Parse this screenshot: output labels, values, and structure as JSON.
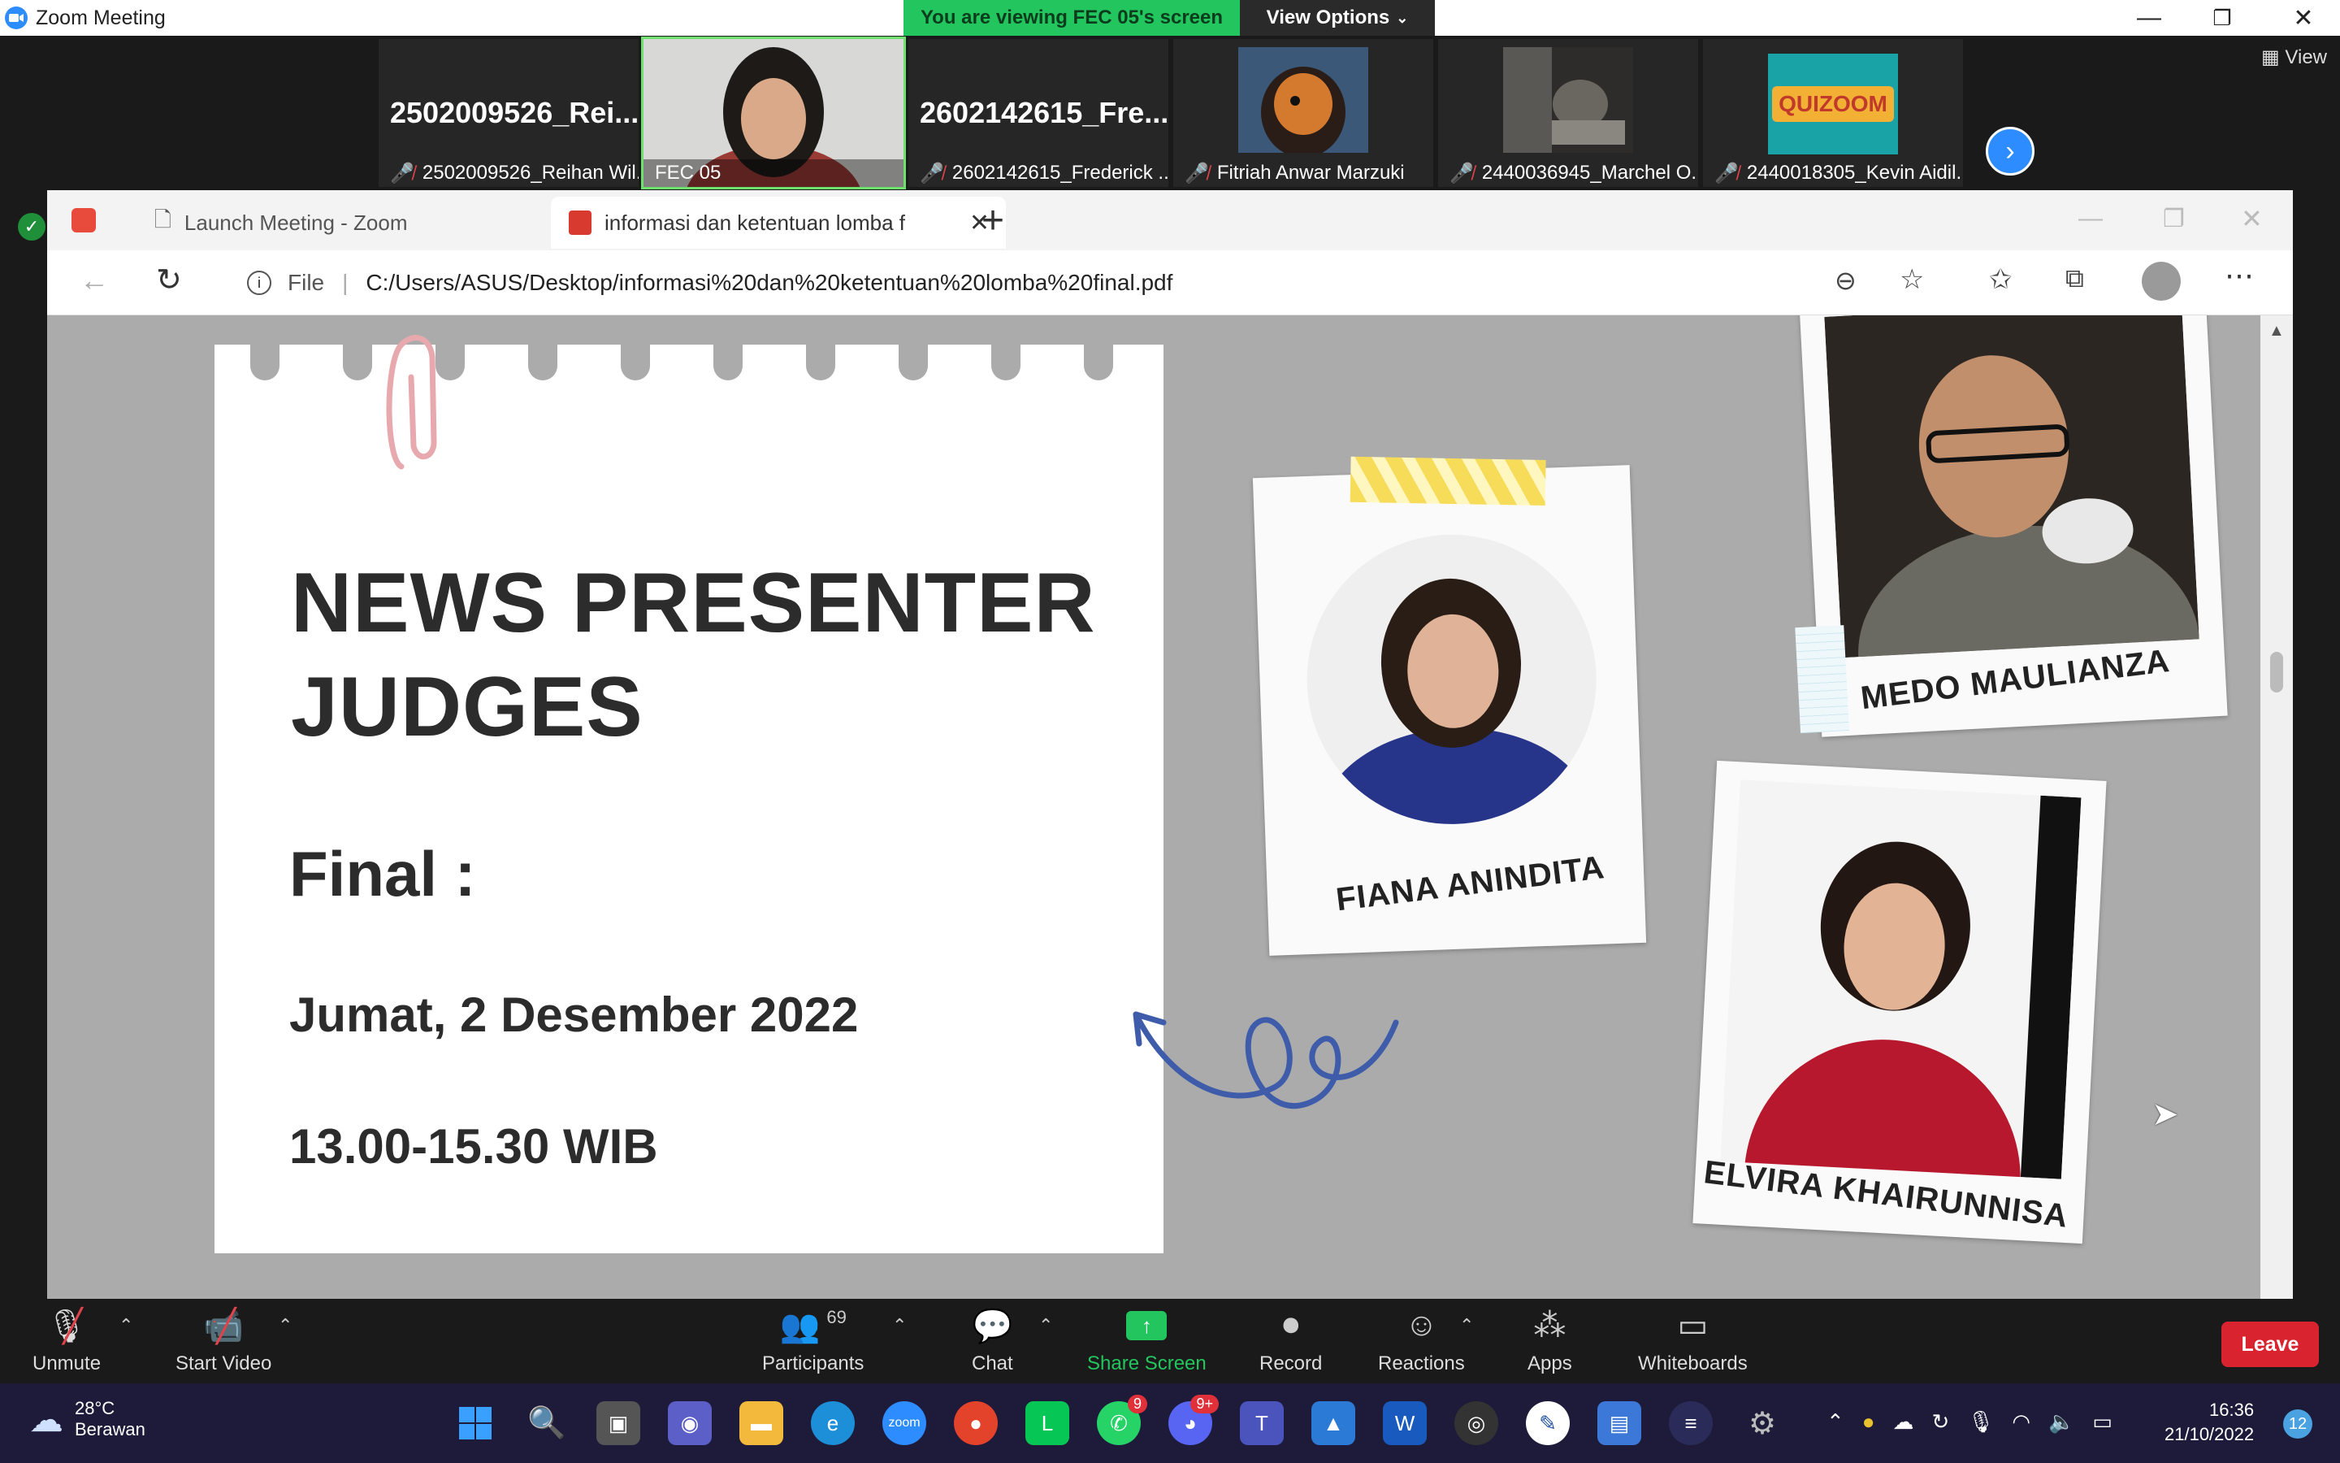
{
  "window": {
    "title": "Zoom Meeting",
    "minimize": "—",
    "restore": "❐",
    "close": "✕"
  },
  "banner": {
    "viewing": "You are viewing FEC 05's screen",
    "view_options": "View Options"
  },
  "thumbnails": {
    "view_label": "View",
    "tiles": [
      {
        "big": "2502009526_Rei...",
        "name": "2502009526_Reihan Wil...",
        "muted": true
      },
      {
        "big": "",
        "name": "FEC 05",
        "muted": false
      },
      {
        "big": "2602142615_Fre...",
        "name": "2602142615_Frederick ...",
        "muted": true
      },
      {
        "big": "",
        "name": "Fitriah Anwar Marzuki",
        "muted": true
      },
      {
        "big": "",
        "name": "2440036945_Marchel O...",
        "muted": true
      },
      {
        "big": "",
        "name": "2440018305_Kevin Aidil...",
        "muted": true
      }
    ],
    "quizoom_logo": "QUIZOOM"
  },
  "browser": {
    "tabs": [
      {
        "label": "Launch Meeting - Zoom"
      },
      {
        "label": "informasi dan ketentuan lomba f"
      }
    ],
    "new_tab": "+",
    "file_label": "File",
    "url": "C:/Users/ASUS/Desktop/informasi%20dan%20ketentuan%20lomba%20final.pdf"
  },
  "slide": {
    "title_line1": "NEWS PRESENTER",
    "title_line2": "JUDGES",
    "final_label": "Final :",
    "date": "Jumat, 2 Desember 2022",
    "time": "13.00-15.30 WIB",
    "judges": [
      "MEDO MAULIANZA",
      "FIANA ANINDITA",
      "ELVIRA KHAIRUNNISA"
    ]
  },
  "controls": {
    "unmute": "Unmute",
    "start_video": "Start Video",
    "participants": "Participants",
    "participants_count": "69",
    "chat": "Chat",
    "share_screen": "Share Screen",
    "record": "Record",
    "reactions": "Reactions",
    "apps": "Apps",
    "whiteboards": "Whiteboards",
    "leave": "Leave"
  },
  "taskbar": {
    "temperature": "28°C",
    "weather": "Berawan",
    "time": "16:36",
    "date": "21/10/2022",
    "whatsapp_badge": "9",
    "discord_badge": "9+",
    "notification_count": "12"
  }
}
